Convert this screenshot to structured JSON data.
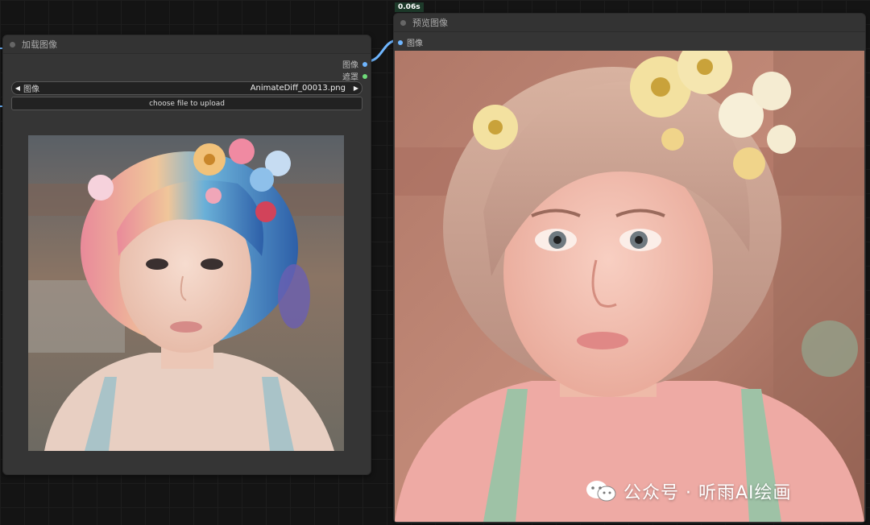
{
  "exec_time": "0.06s",
  "load_image_node": {
    "title": "加载图像",
    "outputs": [
      {
        "label": "图像",
        "color": "#6fb6ff"
      },
      {
        "label": "遮罩",
        "color": "#6fdc7a"
      }
    ],
    "image_widget": {
      "label": "图像",
      "value": "AnimateDiff_00013.png"
    },
    "upload_label": "choose file to upload"
  },
  "preview_node": {
    "title": "预览图像",
    "input_label": "图像"
  },
  "watermark": "公众号 · 听雨AI绘画",
  "colors": {
    "link": "#6fb6ff",
    "mask_socket": "#6fdc7a"
  }
}
